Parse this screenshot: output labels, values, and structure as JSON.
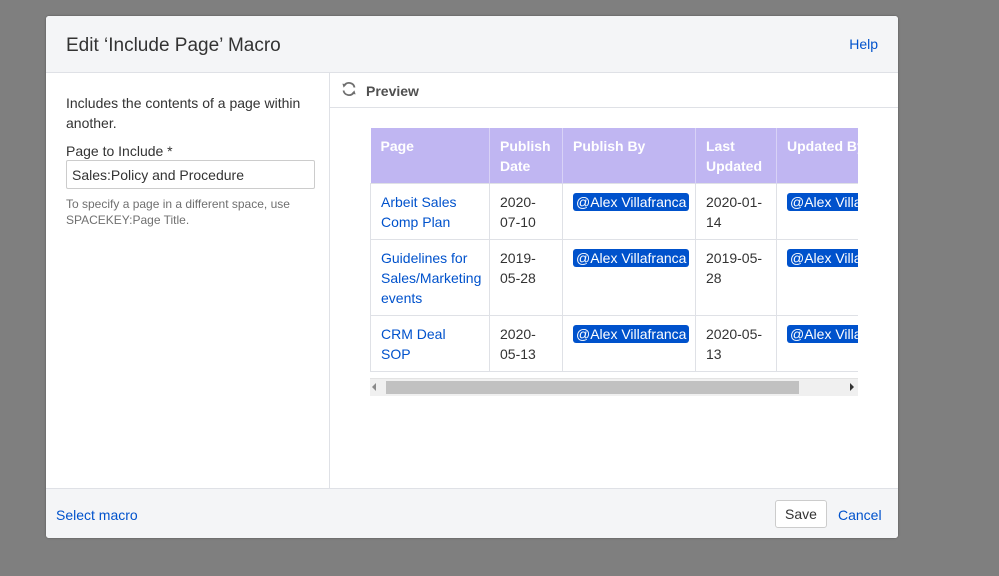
{
  "dialog": {
    "title": "Edit ‘Include Page’ Macro",
    "help_label": "Help"
  },
  "left": {
    "description": "Includes the contents of a page within another.",
    "field_label": "Page to Include *",
    "field_value": "Sales:Policy and Procedure",
    "hint": "To specify a page in a different space, use SPACEKEY:Page Title."
  },
  "preview": {
    "label": "Preview",
    "icon": "refresh-icon",
    "table": {
      "headers": [
        "Page",
        "Publish Date",
        "Publish By",
        "Last Updated",
        "Updated By"
      ],
      "rows": [
        {
          "page": "Arbeit Sales Comp Plan",
          "publish_date": "2020-07-10",
          "publish_by": "@Alex Villafranca",
          "last_updated": "2020-01-14",
          "updated_by": "@Alex Villafranca"
        },
        {
          "page": "Guidelines for Sales/Marketing events",
          "publish_date": "2019-05-28",
          "publish_by": "@Alex Villafranca",
          "last_updated": "2019-05-28",
          "updated_by": "@Alex Villafranca"
        },
        {
          "page": "CRM Deal SOP",
          "publish_date": "2020-05-13",
          "publish_by": "@Alex Villafranca",
          "last_updated": "2020-05-13",
          "updated_by": "@Alex Villafranca"
        }
      ]
    }
  },
  "footer": {
    "select_macro": "Select macro",
    "save": "Save",
    "cancel": "Cancel"
  },
  "colors": {
    "overlay": "#7f7f7f",
    "header_bg": "#f4f5f7",
    "link": "#0052cc",
    "table_header_bg": "#c0b6f2",
    "mention_bg": "#0052cc"
  }
}
